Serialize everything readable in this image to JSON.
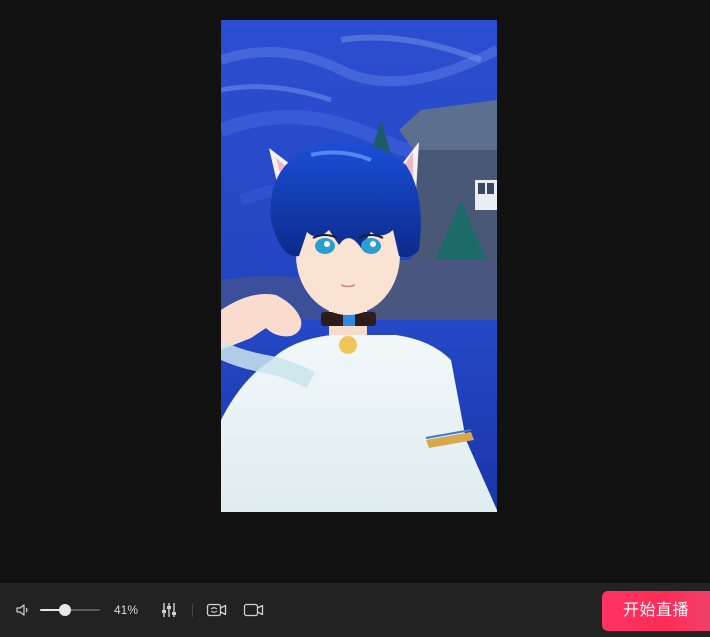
{
  "volume": {
    "level_percent": 41,
    "level_label": "41%"
  },
  "controls": {
    "volume_icon": "speaker-icon",
    "mixer_icon": "sliders-icon",
    "camera_switch_icon": "camera-switch-icon",
    "camera_icon": "camera-icon"
  },
  "start_live": {
    "label": "开始直播",
    "color": "#fe2c55"
  },
  "preview": {
    "content": "anime-avatar-with-cat-ears"
  }
}
